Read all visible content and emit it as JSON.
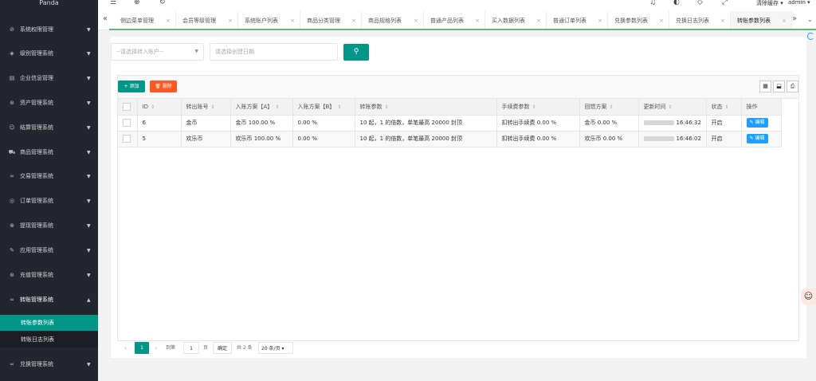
{
  "sidebar": {
    "brand": "Panda",
    "items": [
      {
        "label": "系统权限管理",
        "icon": "shield-icon",
        "glyph": "⊘"
      },
      {
        "label": "级别管理系统",
        "icon": "diamond-icon",
        "glyph": "◈"
      },
      {
        "label": "企业信息管理",
        "icon": "document-icon",
        "glyph": "▤"
      },
      {
        "label": "资产管理系统",
        "icon": "coin-icon",
        "glyph": "⊛"
      },
      {
        "label": "结算管理系统",
        "icon": "smile-icon",
        "glyph": "☺"
      },
      {
        "label": "商品管理系统",
        "icon": "cart-icon",
        "glyph": "⛟"
      },
      {
        "label": "交易管理系统",
        "icon": "link-icon",
        "glyph": "∞"
      },
      {
        "label": "订单管理系统",
        "icon": "location-icon",
        "glyph": "◎"
      },
      {
        "label": "提现管理系统",
        "icon": "circle-x-icon",
        "glyph": "⊗"
      },
      {
        "label": "应用管理系统",
        "icon": "edit-icon",
        "glyph": "✎"
      },
      {
        "label": "充值管理系统",
        "icon": "coin-icon",
        "glyph": "⊛"
      },
      {
        "label": "转账管理系统",
        "icon": "link-icon",
        "glyph": "∞"
      },
      {
        "label": "兑换管理系统",
        "icon": "link-icon",
        "glyph": "∞"
      }
    ],
    "sub_items": [
      {
        "label": "转账参数列表"
      },
      {
        "label": "转账日志列表"
      }
    ]
  },
  "header": {
    "icons": [
      "menu-icon",
      "globe-icon",
      "refresh-icon",
      "bell-icon",
      "theme-icon",
      "tag-icon",
      "fullscreen-icon"
    ],
    "clear_cache": "清除缓存",
    "user": "admin"
  },
  "tabs": [
    {
      "label": "侧边菜单管理"
    },
    {
      "label": "会员等级管理"
    },
    {
      "label": "系统账户列表"
    },
    {
      "label": "商品分类管理"
    },
    {
      "label": "商品规格列表"
    },
    {
      "label": "普通产品列表"
    },
    {
      "label": "买入数据列表"
    },
    {
      "label": "普通订单列表"
    },
    {
      "label": "兑换参数列表"
    },
    {
      "label": "兑换日志列表"
    },
    {
      "label": "转账参数列表"
    }
  ],
  "filters": {
    "account_placeholder": "--请选择转入账户--",
    "date_placeholder": "请选择创建日期"
  },
  "toolbar": {
    "add_label": "添加",
    "delete_label": "删除"
  },
  "table": {
    "columns": [
      "ID",
      "转出账号",
      "入账方案【A】",
      "入账方案【B】",
      "转账参数",
      "手续费参数",
      "回馈方案",
      "更新时间",
      "状态",
      "操作"
    ],
    "rows": [
      {
        "id": "6",
        "from": "金币",
        "plan_a": "金币 100.00 %",
        "plan_b": "0.00 %",
        "params": "10 起，1 的倍数，单笔最高 20000 封顶",
        "fee": "扣转出手续费 0.00 %",
        "feedback": "金币 0.00 %",
        "time": "16:46:32",
        "status": "开启",
        "action": "编辑"
      },
      {
        "id": "5",
        "from": "欢乐币",
        "plan_a": "欢乐币 100.00 %",
        "plan_b": "0.00 %",
        "params": "10 起，1 的倍数，单笔最高 20000 封顶",
        "fee": "扣转出手续费 0.00 %",
        "feedback": "欢乐币 0.00 %",
        "time": "16:46:02",
        "status": "开启",
        "action": "编辑"
      }
    ]
  },
  "pagination": {
    "current": "1",
    "goto_label": "到第",
    "input_value": "1",
    "page_unit": "页",
    "confirm": "确定",
    "total": "共 2 条",
    "limit": "20 条/页"
  },
  "colors": {
    "sidebar_bg": "#23262e",
    "accent": "#009688",
    "danger": "#ff5722",
    "edit": "#1e9fff"
  }
}
